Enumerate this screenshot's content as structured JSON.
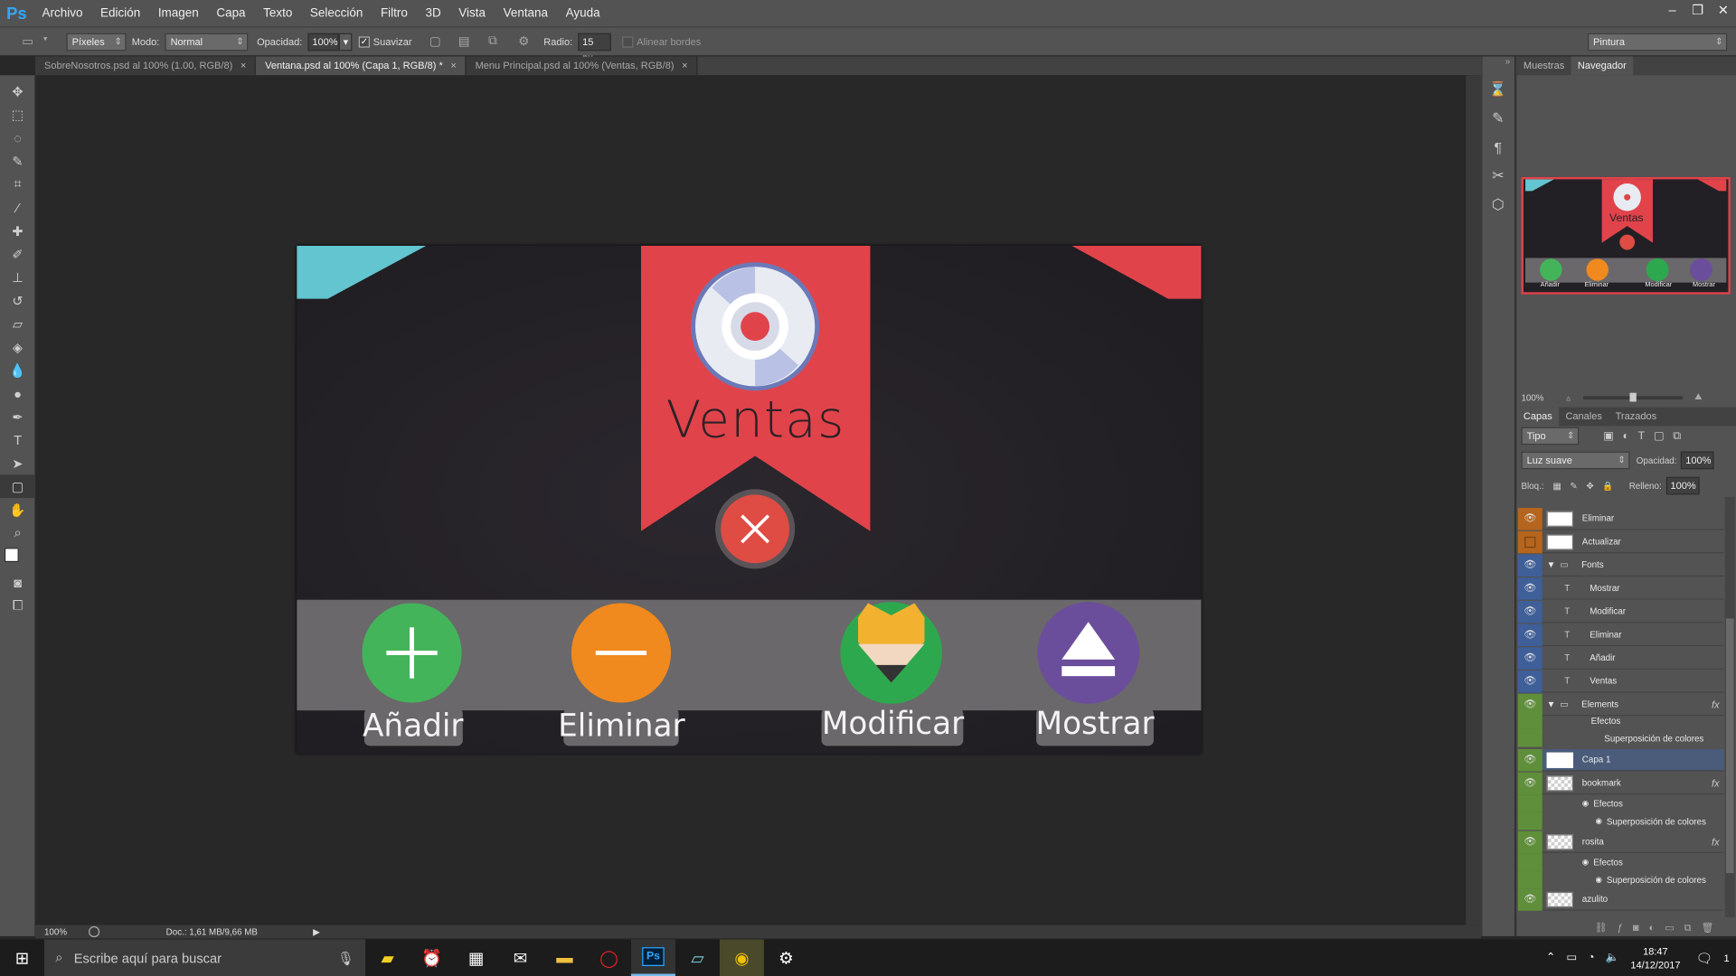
{
  "app": {
    "logo": "Ps"
  },
  "menu": [
    "Archivo",
    "Edición",
    "Imagen",
    "Capa",
    "Texto",
    "Selección",
    "Filtro",
    "3D",
    "Vista",
    "Ventana",
    "Ayuda"
  ],
  "options": {
    "units_value": "Píxeles",
    "mode_label": "Modo:",
    "mode_value": "Normal",
    "opacity_label": "Opacidad:",
    "opacity_value": "100%",
    "smooth_label": "Suavizar",
    "radius_label": "Radio:",
    "radius_value": "15 px",
    "align_label": "Alinear bordes",
    "workspace_value": "Pintura"
  },
  "tabs": [
    {
      "label": "SobreNosotros.psd al 100% (1.00, RGB/8)",
      "active": false
    },
    {
      "label": "Ventana.psd al 100% (Capa 1, RGB/8) *",
      "active": true
    },
    {
      "label": "Menu Principal.psd al 100% (Ventas, RGB/8)",
      "active": false
    }
  ],
  "document": {
    "title": "Ventas",
    "buttons": [
      {
        "label": "Añadir",
        "icon": "plus-icon",
        "color": "#44b45a"
      },
      {
        "label": "Eliminar",
        "icon": "minus-icon",
        "color": "#f0891e"
      },
      {
        "label": "Modificar",
        "icon": "pencil-icon",
        "color": "#2ea84e"
      },
      {
        "label": "Mostrar",
        "icon": "eject-icon",
        "color": "#6b4e9b"
      }
    ],
    "colors": {
      "ribbon": "#e1434b",
      "teal": "#62c5cf",
      "bg": "#222024",
      "bar": "#6a686a"
    }
  },
  "status": {
    "zoom": "100%",
    "doc_info": "Doc.: 1,61 MB/9,66 MB"
  },
  "navigator": {
    "tabs": [
      "Muestras",
      "Navegador"
    ],
    "active_tab": "Navegador",
    "zoom": "100%",
    "thumb_title": "Ventas",
    "thumb_labels": [
      "Añadir",
      "Eliminar",
      "Modificar",
      "Mostrar"
    ]
  },
  "layers_panel": {
    "tabs": [
      "Capas",
      "Canales",
      "Trazados"
    ],
    "active_tab": "Capas",
    "filter_value": "Tipo",
    "blend_value": "Luz suave",
    "opacity_label": "Opacidad:",
    "opacity_value": "100%",
    "lock_label": "Bloq.:",
    "fill_label": "Relleno:",
    "fill_value": "100%",
    "layers": [
      {
        "name": "Eliminar",
        "kind": "smart",
        "color": "#b5651d",
        "eye": true
      },
      {
        "name": "Actualizar",
        "kind": "smart",
        "color": "#b5651d",
        "eye": false
      },
      {
        "name": "Fonts",
        "kind": "group",
        "color": "#3f5f99",
        "eye": true
      },
      {
        "name": "Mostrar",
        "kind": "text",
        "color": "#3f5f99",
        "eye": true
      },
      {
        "name": "Modificar",
        "kind": "text",
        "color": "#3f5f99",
        "eye": true
      },
      {
        "name": "Eliminar",
        "kind": "text",
        "color": "#3f5f99",
        "eye": true
      },
      {
        "name": "Añadir",
        "kind": "text",
        "color": "#3f5f99",
        "eye": true
      },
      {
        "name": "Ventas",
        "kind": "text",
        "color": "#3f5f99",
        "eye": true
      },
      {
        "name": "Elements",
        "kind": "group",
        "color": "#5f8f3a",
        "eye": true,
        "fx": true
      },
      {
        "name": "Efectos",
        "kind": "effect",
        "color": "#5f8f3a"
      },
      {
        "name": "Superposición de colores",
        "kind": "effect",
        "color": "#5f8f3a"
      },
      {
        "name": "Capa 1",
        "kind": "layer",
        "color": "#5f8f3a",
        "eye": true,
        "selected": true
      },
      {
        "name": "bookmark",
        "kind": "layer",
        "color": "#5f8f3a",
        "eye": true,
        "fx": true
      },
      {
        "name": "Efectos",
        "kind": "effect",
        "color": "#5f8f3a"
      },
      {
        "name": "Superposición de colores",
        "kind": "effect",
        "color": "#5f8f3a"
      },
      {
        "name": "rosita",
        "kind": "layer",
        "color": "#5f8f3a",
        "eye": true,
        "fx": true
      },
      {
        "name": "Efectos",
        "kind": "effect",
        "color": "#5f8f3a"
      },
      {
        "name": "Superposición de colores",
        "kind": "effect",
        "color": "#5f8f3a"
      },
      {
        "name": "azulito",
        "kind": "layer",
        "color": "#5f8f3a",
        "eye": true
      }
    ]
  },
  "taskbar": {
    "search_placeholder": "Escribe aquí para buscar",
    "time": "18:47",
    "date": "14/12/2017",
    "notif_count": "1"
  }
}
